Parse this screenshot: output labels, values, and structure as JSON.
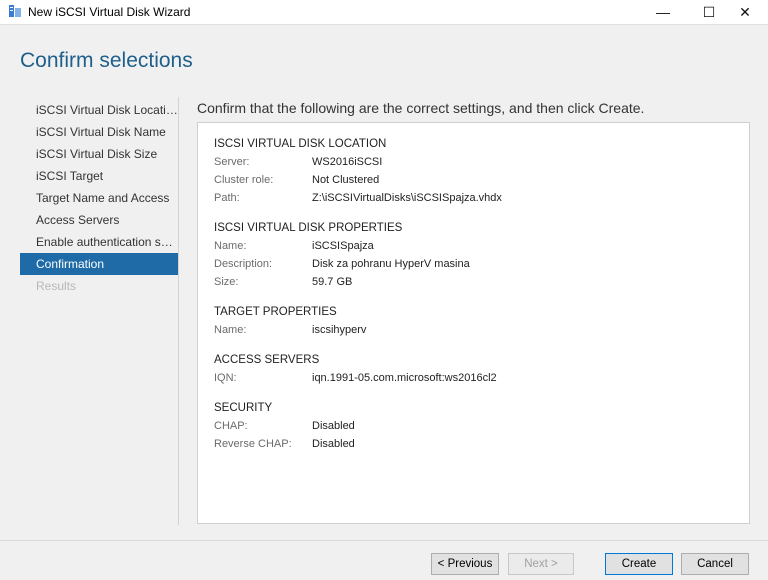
{
  "window": {
    "title": "New iSCSI Virtual Disk Wizard",
    "minimize_glyph": "—",
    "maximize_glyph": "☐",
    "close_glyph": "✕"
  },
  "page": {
    "title": "Confirm selections",
    "instruction": "Confirm that the following are the correct settings, and then click Create."
  },
  "nav": {
    "items": [
      {
        "label": "iSCSI Virtual Disk Location",
        "state": "normal"
      },
      {
        "label": "iSCSI Virtual Disk Name",
        "state": "normal"
      },
      {
        "label": "iSCSI Virtual Disk Size",
        "state": "normal"
      },
      {
        "label": "iSCSI Target",
        "state": "normal"
      },
      {
        "label": "Target Name and Access",
        "state": "normal"
      },
      {
        "label": "Access Servers",
        "state": "normal"
      },
      {
        "label": "Enable authentication ser...",
        "state": "normal"
      },
      {
        "label": "Confirmation",
        "state": "active"
      },
      {
        "label": "Results",
        "state": "disabled"
      }
    ]
  },
  "summary": {
    "sections": [
      {
        "title": "ISCSI VIRTUAL DISK LOCATION",
        "rows": [
          {
            "key": "Server:",
            "value": "WS2016iSCSI"
          },
          {
            "key": "Cluster role:",
            "value": "Not Clustered"
          },
          {
            "key": "Path:",
            "value": "Z:\\iSCSIVirtualDisks\\iSCSISpajza.vhdx"
          }
        ]
      },
      {
        "title": "ISCSI VIRTUAL DISK PROPERTIES",
        "rows": [
          {
            "key": "Name:",
            "value": "iSCSISpajza"
          },
          {
            "key": "Description:",
            "value": "Disk za pohranu HyperV masina"
          },
          {
            "key": "Size:",
            "value": "59.7 GB"
          }
        ]
      },
      {
        "title": "TARGET PROPERTIES",
        "rows": [
          {
            "key": "Name:",
            "value": "iscsihyperv"
          }
        ]
      },
      {
        "title": "ACCESS SERVERS",
        "rows": [
          {
            "key": "IQN:",
            "value": "iqn.1991-05.com.microsoft:ws2016cl2"
          }
        ]
      },
      {
        "title": "SECURITY",
        "rows": [
          {
            "key": "CHAP:",
            "value": "Disabled"
          },
          {
            "key": "Reverse CHAP:",
            "value": "Disabled"
          }
        ]
      }
    ]
  },
  "buttons": {
    "previous": "< Previous",
    "next": "Next >",
    "create": "Create",
    "cancel": "Cancel"
  },
  "colors": {
    "title_blue": "#1f5f8b",
    "active_nav": "#1e6ba8"
  }
}
